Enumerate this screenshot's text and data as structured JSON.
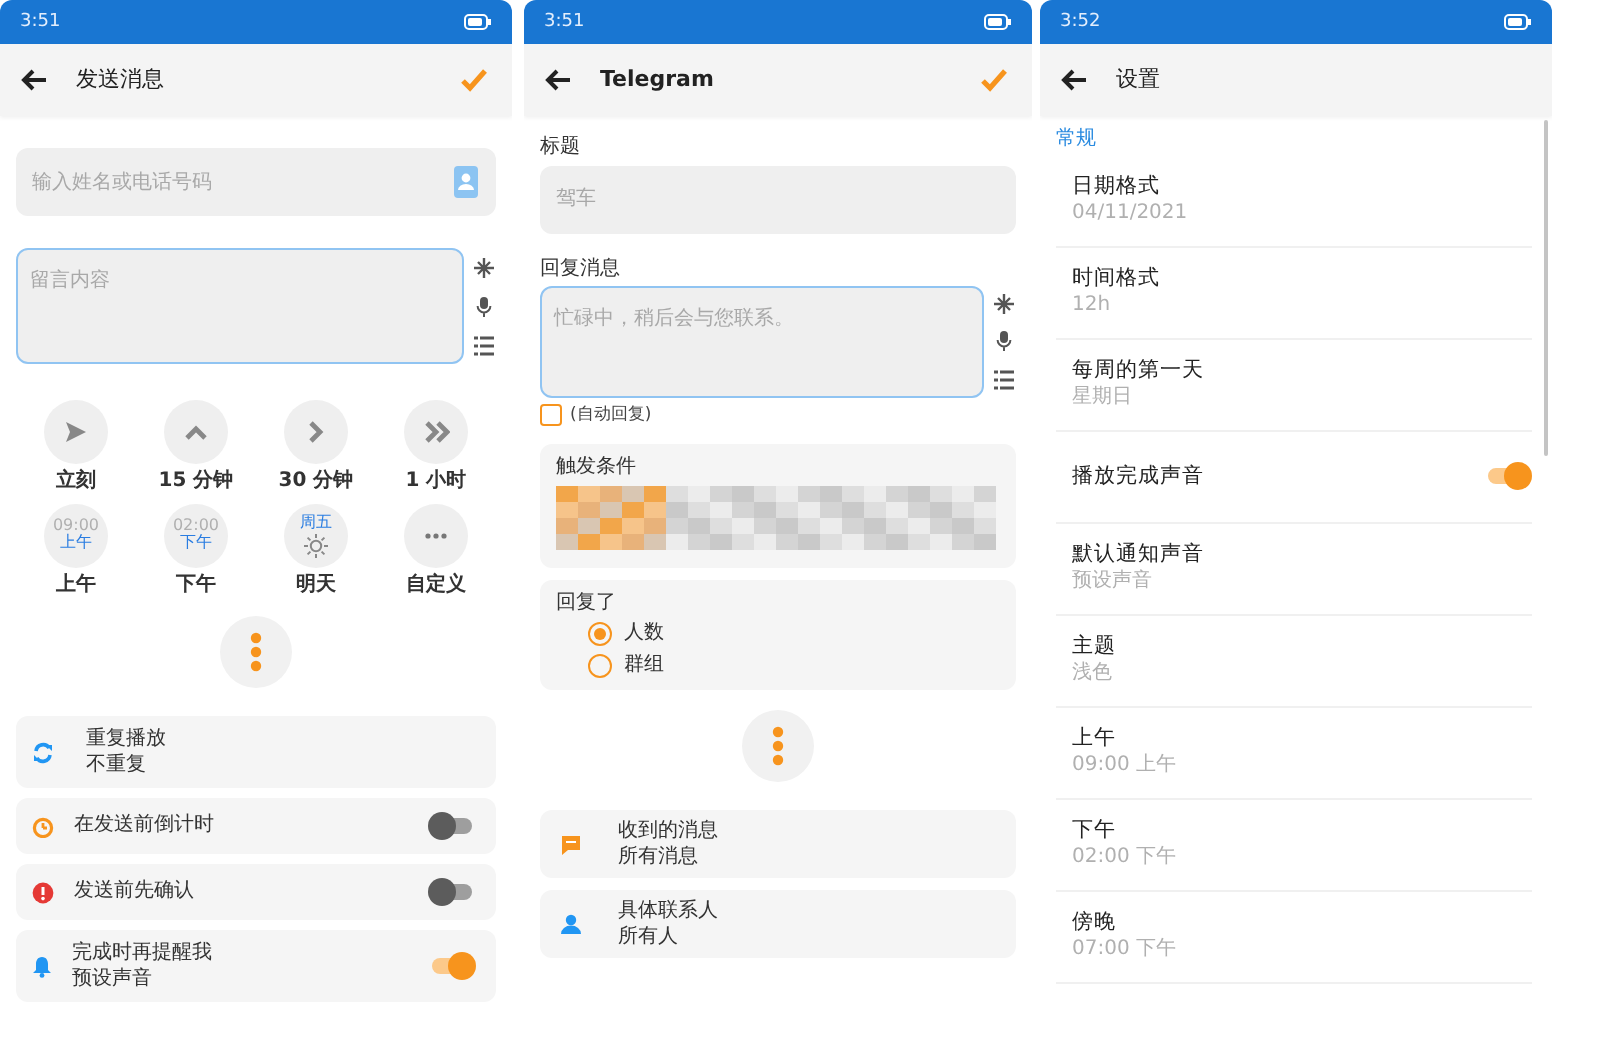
{
  "compose_screen": {
    "status_time": "3:51",
    "title": "发送消息",
    "recipient": {
      "placeholder": "输入姓名或电话号码"
    },
    "message": {
      "placeholder": "留言内容"
    },
    "quick_times": [
      {
        "label": "立刻"
      },
      {
        "label": "15 分钟"
      },
      {
        "label": "30 分钟"
      },
      {
        "label": "1 小时"
      },
      {
        "time": "09:00",
        "period": "上午",
        "label": "上午"
      },
      {
        "time": "02:00",
        "period": "下午",
        "label": "下午"
      },
      {
        "weekday": "周五",
        "label": "明天"
      },
      {
        "label": "自定义"
      }
    ],
    "options": [
      {
        "kind": "info",
        "title": "重复播放",
        "subtitle": "不重复"
      },
      {
        "kind": "toggle",
        "title": "在发送前倒计时",
        "on": false
      },
      {
        "kind": "toggle",
        "title": "发送前先确认",
        "on": false
      },
      {
        "kind": "toggle",
        "title": "完成时再提醒我",
        "subtitle": "预设声音",
        "on": true
      }
    ]
  },
  "rule_screen": {
    "status_time": "3:51",
    "title": "Telegram",
    "title_field": {
      "label": "标题",
      "placeholder": "驾车"
    },
    "reply": {
      "label": "回复消息",
      "placeholder": "忙碌中，稍后会与您联系。"
    },
    "auto_reply": {
      "label": "(自动回复)",
      "checked": false
    },
    "trigger": {
      "label": "触发条件"
    },
    "replied_to": {
      "label": "回复了",
      "options": [
        {
          "label": "人数",
          "selected": true
        },
        {
          "label": "群组",
          "selected": false
        }
      ]
    },
    "filters": [
      {
        "title": "收到的消息",
        "subtitle": "所有消息"
      },
      {
        "title": "具体联系人",
        "subtitle": "所有人"
      }
    ]
  },
  "settings_screen": {
    "status_time": "3:52",
    "title": "设置",
    "section": "常规",
    "items": [
      {
        "kind": "value",
        "title": "日期格式",
        "value": "04/11/2021"
      },
      {
        "kind": "value",
        "title": "时间格式",
        "value": "12h"
      },
      {
        "kind": "value",
        "title": "每周的第一天",
        "value": "星期日"
      },
      {
        "kind": "toggle",
        "title": "播放完成声音",
        "on": true
      },
      {
        "kind": "value",
        "title": "默认通知声音",
        "value": "预设声音"
      },
      {
        "kind": "value",
        "title": "主题",
        "value": "浅色"
      },
      {
        "kind": "value",
        "title": "上午",
        "value": "09:00 上午"
      },
      {
        "kind": "value",
        "title": "下午",
        "value": "02:00 下午"
      },
      {
        "kind": "value",
        "title": "傍晚",
        "value": "07:00 下午"
      }
    ]
  }
}
